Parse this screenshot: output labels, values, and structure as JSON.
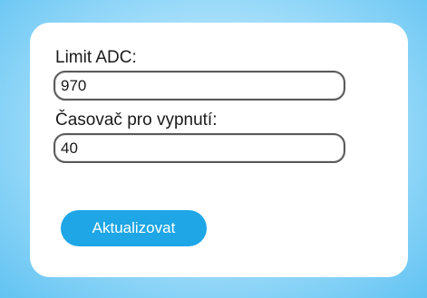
{
  "form": {
    "adc_limit_label": "Limit ADC:",
    "adc_limit_value": "970",
    "timer_label": "Časovač pro vypnutí:",
    "timer_value": "40",
    "submit_label": "Aktualizovat"
  },
  "colors": {
    "accent": "#1ea6e6",
    "background": "#a9e0fb",
    "card": "#ffffff"
  }
}
